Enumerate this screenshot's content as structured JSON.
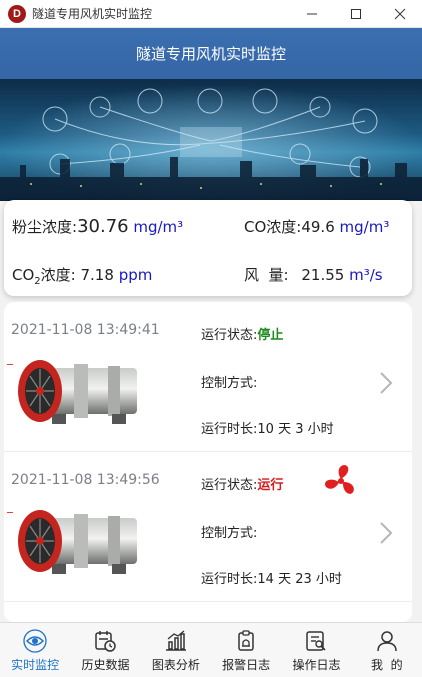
{
  "window": {
    "title": "隧道专用风机实时监控",
    "icon_letter": "D"
  },
  "header": {
    "title": "隧道专用风机实时监控"
  },
  "sensors": {
    "dust": {
      "label": "粉尘浓度:",
      "value": "30.76",
      "unit": "mg/m³"
    },
    "co": {
      "label": "CO浓度:",
      "value": "49.6",
      "unit": "mg/m³"
    },
    "co2": {
      "label_main": "CO",
      "label_sub": "2",
      "label_suffix": "浓度:",
      "value": "7.18",
      "unit": "ppm"
    },
    "wind": {
      "label": "风  量:",
      "value": "21.55",
      "unit": "m³/s"
    }
  },
  "devices": [
    {
      "time": "2021-11-08 13:49:41",
      "status_label": "运行状态:",
      "status": "停止",
      "control_label": "控制方式:",
      "control": "",
      "runtime_label": "运行时长:",
      "runtime": "10 天 3 小时"
    },
    {
      "time": "2021-11-08 13:49:56",
      "status_label": "运行状态:",
      "status": "运行",
      "control_label": "控制方式:",
      "control": "",
      "runtime_label": "运行时长:",
      "runtime": "14 天 23 小时"
    }
  ],
  "tabs": [
    {
      "label": "实时监控",
      "icon": "eye-icon"
    },
    {
      "label": "历史数据",
      "icon": "calendar-clock-icon"
    },
    {
      "label": "图表分析",
      "icon": "bar-chart-icon"
    },
    {
      "label": "报警日志",
      "icon": "alarm-log-icon"
    },
    {
      "label": "操作日志",
      "icon": "operation-log-icon"
    },
    {
      "label": "我  的",
      "icon": "user-icon"
    }
  ],
  "colors": {
    "header": "#3566a6",
    "accent": "#1e73c8",
    "stop": "#1f8a1f",
    "run": "#d81c1c",
    "unit": "#1818c8"
  }
}
